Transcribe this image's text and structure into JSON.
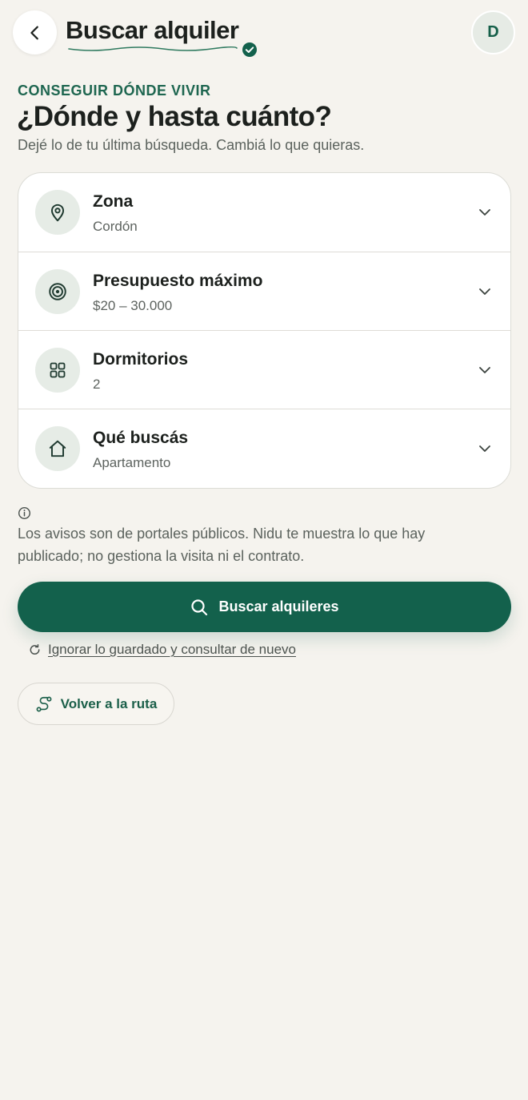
{
  "header": {
    "title": "Buscar alquiler",
    "avatar_initial": "D"
  },
  "intro": {
    "eyebrow": "CONSEGUIR DÓNDE VIVIR",
    "heading": "¿Dónde y hasta cuánto?",
    "subtitle": "Dejé lo de tu última búsqueda. Cambiá lo que quieras."
  },
  "filters": [
    {
      "icon": "map-pin-icon",
      "label": "Zona",
      "value": "Cordón"
    },
    {
      "icon": "target-icon",
      "label": "Presupuesto máximo",
      "value": "$20 – 30.000"
    },
    {
      "icon": "grid-icon",
      "label": "Dormitorios",
      "value": "2"
    },
    {
      "icon": "home-icon",
      "label": "Qué buscás",
      "value": "Apartamento"
    }
  ],
  "disclaimer": "Los avisos son de portales públicos. Nidu te muestra lo que hay publicado; no gestiona la visita ni el contrato.",
  "actions": {
    "search_label": "Buscar alquileres",
    "reset_label": "Ignorar lo guardado y consultar de nuevo",
    "route_label": "Volver a la ruta"
  },
  "colors": {
    "background": "#f5f3ee",
    "brand": "#13614c",
    "eyebrow": "#1e6650",
    "icon_bg": "#e6ece6"
  }
}
